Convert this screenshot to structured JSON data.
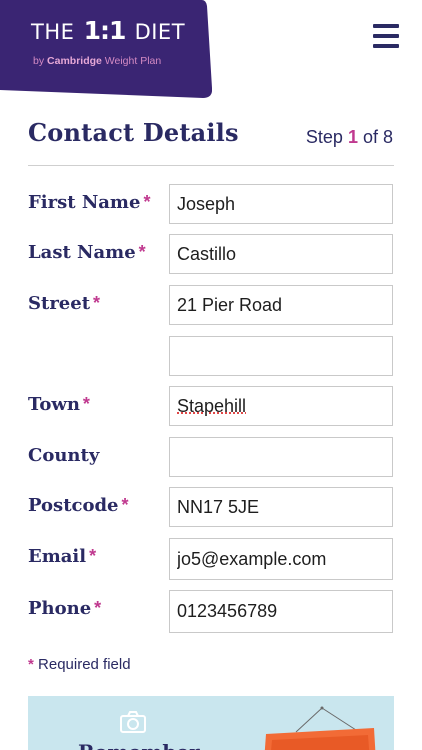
{
  "header": {
    "logo_left": "THE",
    "logo_ratio": "1:1",
    "logo_right": "DIET",
    "logo_sub_prefix": "by",
    "logo_sub_brand": "Cambridge",
    "logo_sub_suffix": "Weight Plan",
    "menu_icon": "hamburger-menu-icon"
  },
  "page": {
    "title": "Contact Details",
    "step_prefix": "Step",
    "step_current": "1",
    "step_suffix": "of 8"
  },
  "form": {
    "required_marker": "*",
    "fields": {
      "first_name": {
        "label": "First Name",
        "value": "Joseph"
      },
      "last_name": {
        "label": "Last Name",
        "value": "Castillo"
      },
      "street": {
        "label": "Street",
        "value": "21 Pier Road"
      },
      "street2": {
        "value": ""
      },
      "town": {
        "label": "Town",
        "value": "Stapehill"
      },
      "county": {
        "label": "County",
        "value": ""
      },
      "postcode": {
        "label": "Postcode",
        "value": "NN17 5JE"
      },
      "email": {
        "label": "Email",
        "value": "jo5@example.com"
      },
      "phone": {
        "label": "Phone",
        "value": "0123456789"
      }
    },
    "required_note": "Required field"
  },
  "promo": {
    "heading": "Remember",
    "icon": "camera-icon"
  },
  "colors": {
    "brand_purple": "#3a2573",
    "navy": "#2a2a63",
    "accent_pink": "#c0398f",
    "promo_bg": "#c9e6ee",
    "promo_orange": "#f26b36"
  }
}
